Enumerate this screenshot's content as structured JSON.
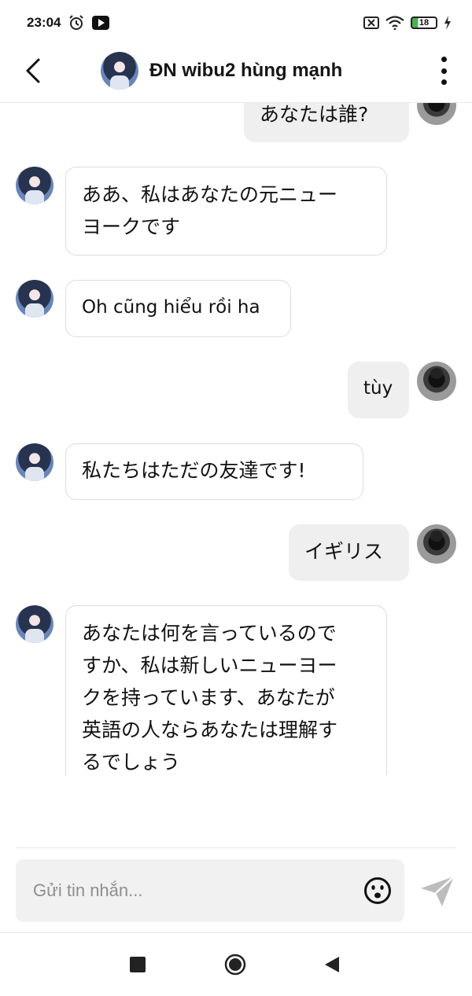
{
  "status_bar": {
    "time": "23:04",
    "battery": "18",
    "icons": [
      "alarm-icon",
      "youtube-icon",
      "sim-off-icon",
      "wifi-icon",
      "battery-icon",
      "charging-icon"
    ]
  },
  "header": {
    "title": "ĐN wibu2 hùng mạnh"
  },
  "messages": [
    {
      "sender": "me",
      "text": "あなたは誰?"
    },
    {
      "sender": "bot",
      "lines": [
        "ああ、私はあなたの元ニュー",
        "ヨークです"
      ]
    },
    {
      "sender": "bot",
      "text": "Oh cũng hiểu rồi ha"
    },
    {
      "sender": "me",
      "text": "tùy"
    },
    {
      "sender": "bot",
      "text": "私たちはただの友達です!"
    },
    {
      "sender": "me",
      "text": "イギリス"
    },
    {
      "sender": "bot",
      "lines": [
        "あなたは何を言っているので",
        "すか、私は新しいニューヨー",
        "クを持っています、あなたが",
        "英語の人ならあなたは理解す",
        "るでしょう"
      ]
    }
  ],
  "composer": {
    "placeholder": "Gửi tin nhắn..."
  },
  "colors": {
    "bot_bubble_border": "#dcdcdc",
    "my_bubble_bg": "#efefef",
    "send_icon": "#b5b5b5"
  }
}
